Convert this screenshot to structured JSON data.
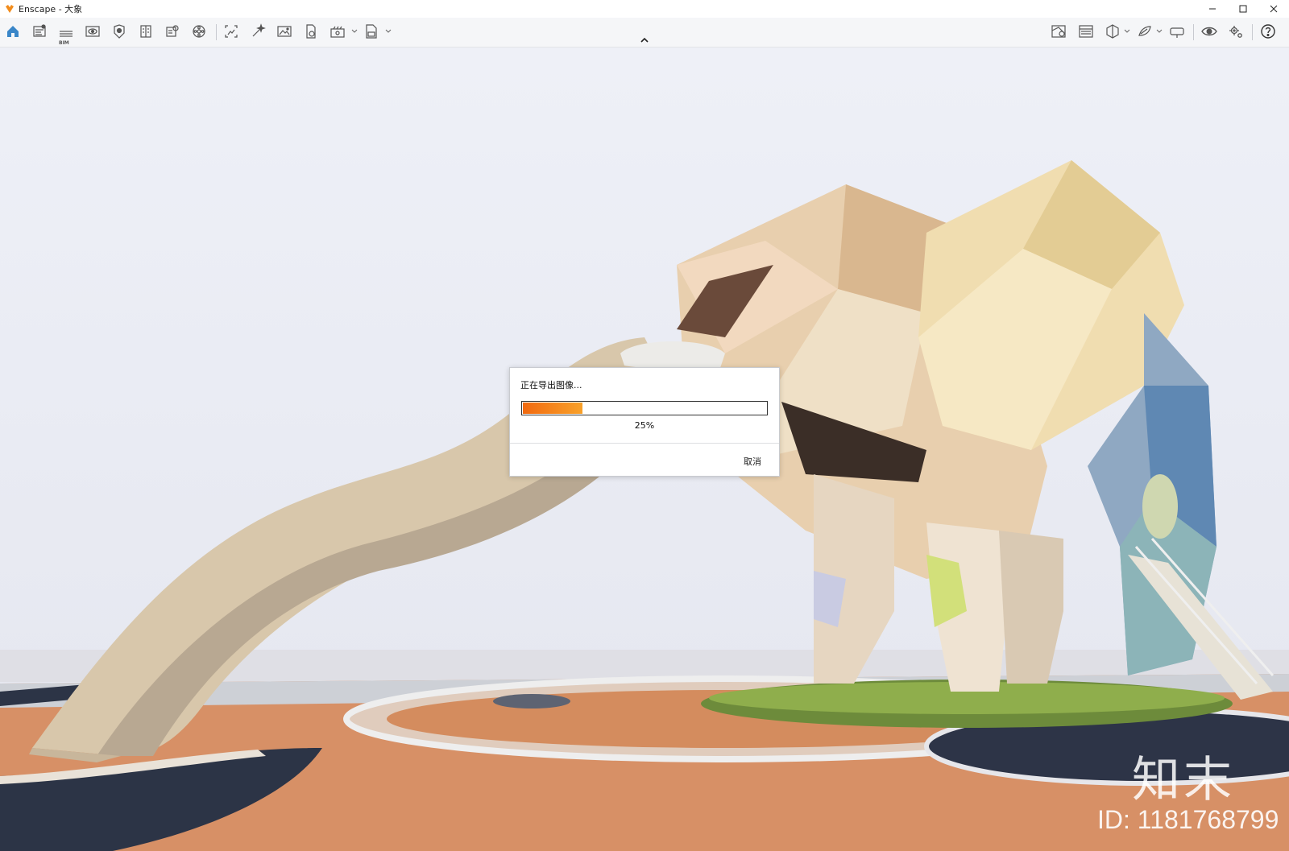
{
  "window": {
    "title": "Enscape - 大象"
  },
  "toolbar": {
    "left_icons": [
      "home-icon",
      "views-icon",
      "bim-icon",
      "visual-settings-icon",
      "asset-library-icon",
      "material-editor-icon",
      "site-context-icon",
      "atmosphere-icon",
      "screenshot-icon",
      "batch-render-icon",
      "panorama-icon",
      "video-editor-icon",
      "export-icon",
      "exe-export-icon"
    ],
    "right_icons": [
      "upload-manager-icon",
      "preview-icon",
      "split-view-icon",
      "sketch-icon",
      "vr-headset-icon",
      "eye-icon",
      "settings-icon",
      "help-icon"
    ],
    "bim_label": "BIM",
    "accent_color": "#3a86c8"
  },
  "dialog": {
    "title": "正在导出图像...",
    "progress": 0.25,
    "percent_text": "25%",
    "cancel_label": "取消"
  },
  "brand": {
    "name": "知末",
    "id_text": "ID: 1181768799"
  }
}
